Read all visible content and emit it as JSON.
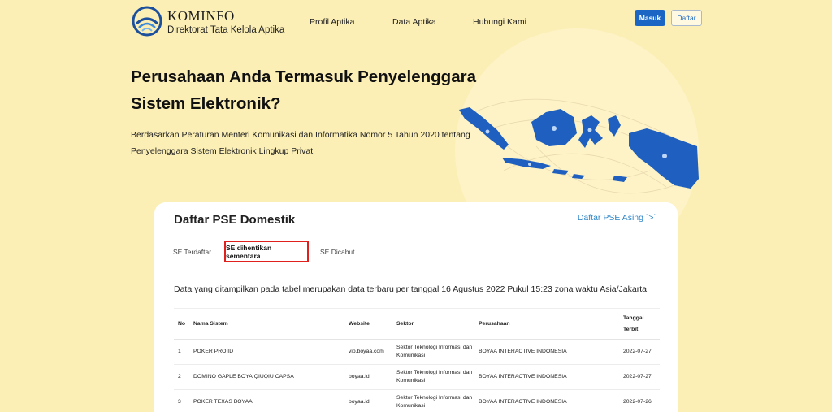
{
  "header": {
    "logo_title": "KOMINFO",
    "logo_subtitle": "Direktorat Tata Kelola Aptika",
    "nav": [
      "Profil Aptika",
      "Data Aptika",
      "Hubungi Kami"
    ],
    "login_label": "Masuk",
    "register_label": "Daftar"
  },
  "hero": {
    "title": "Perusahaan Anda Termasuk Penyelenggara Sistem Elektronik?",
    "description": "Berdasarkan Peraturan Menteri Komunikasi dan Informatika Nomor 5 Tahun 2020 tentang Penyelenggara Sistem Elektronik Lingkup Privat"
  },
  "card": {
    "title": "Daftar PSE Domestik",
    "foreign_link": "Daftar PSE Asing `>`",
    "tabs": [
      "SE Terdaftar",
      "SE dihentikan sementara",
      "SE Dicabut"
    ],
    "active_tab": "SE dihentikan sementara",
    "notice": "Data yang ditampilkan pada tabel merupakan data terbaru per tanggal 16 Agustus 2022 Pukul 15:23 zona waktu Asia/Jakarta.",
    "table": {
      "columns": [
        "No",
        "Nama Sistem",
        "Website",
        "Sektor",
        "Perusahaan",
        "Tanggal Terbit"
      ],
      "rows": [
        [
          "1",
          "POKER PRO.ID",
          "vip.boyaa.com",
          "Sektor Teknologi Informasi dan Komunikasi",
          "BOYAA INTERACTIVE INDONESIA",
          "2022-07-27"
        ],
        [
          "2",
          "DOMINO GAPLE BOYA:QIUQIU CAPSA",
          "boyaa.id",
          "Sektor Teknologi Informasi dan Komunikasi",
          "BOYAA INTERACTIVE INDONESIA",
          "2022-07-27"
        ],
        [
          "3",
          "POKER TEXAS BOYAA",
          "boyaa.id",
          "Sektor Teknologi Informasi dan Komunikasi",
          "BOYAA INTERACTIVE INDONESIA",
          "2022-07-26"
        ]
      ]
    }
  },
  "colors": {
    "background": "#fcefb6",
    "primary": "#1b66c4",
    "highlight": "#e0201c",
    "link": "#2f86c9",
    "map": "#1e5fbf"
  }
}
